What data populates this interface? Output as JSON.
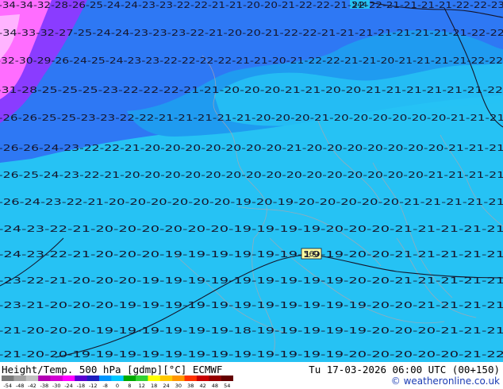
{
  "footer": {
    "left_text": "Height/Temp. 500 hPa [gdmp][°C] ECMWF",
    "right_text": "Tu 17-03-2026 06:00 UTC (00+150)",
    "credit_text": "© weatheronline.co.uk"
  },
  "colorbar": {
    "ticks": [
      "-54",
      "-48",
      "-42",
      "-38",
      "-30",
      "-24",
      "-18",
      "-12",
      "-8",
      "0",
      "8",
      "12",
      "18",
      "24",
      "30",
      "38",
      "42",
      "48",
      "54"
    ],
    "colors": [
      "#7b7b7b",
      "#a3a3a3",
      "#c2c2c2",
      "#b400b4",
      "#d200d2",
      "#ff00ff",
      "#5a00d2",
      "#1e1ebe",
      "#0096ff",
      "#00c8ff",
      "#00aa00",
      "#32d232",
      "#ffff00",
      "#ffc800",
      "#ff9600",
      "#ff3200",
      "#c80000",
      "#960000",
      "#640000"
    ]
  },
  "map": {
    "colors": {
      "magenta": "#ff6dff",
      "pink": "#ffb4ff",
      "purple": "#8a3cff",
      "blue": "#2e78f4",
      "mid_blue": "#1f9bf0",
      "cyan": "#26c2f4",
      "contour": "#15152a",
      "coast": "#b8a4a8"
    },
    "contour_labels": [
      {
        "text": "560",
        "boxed": true
      },
      {
        "text": "544",
        "boxed": true
      }
    ],
    "temp_rows": [
      "-34-34-32-28-26-25-24-24-23-23-22-22-21-21-20-20-21-22-22-21-22-22-21-21-21-21-22-22-23",
      "-34-33-32-27-25-24-24-23-23-23-22-21-20-20-21-22-22-21-21-21-21-21-21-21-21-22-22",
      "-32-30-29-26-24-25-24-23-23-22-22-22-22-21-21-20-21-22-22-21-21-20-21-21-21-21-22-22",
      "-31-28-25-25-25-23-22-22-22-21-21-20-20-20-21-21-20-20-21-21-21-21-21-21-22",
      "-26-26-25-25-23-23-22-22-21-21-21-21-21-20-20-20-21-20-20-20-20-20-20-21-21-21",
      "-26-26-24-23-22-22-21-20-20-20-20-20-20-20-21-20-20-20-20-20-20-20-21-21-21",
      "-26-25-24-23-22-21-20-20-20-20-20-20-20-20-20-20-20-20-20-20-20-21-21-21-21",
      "-26-24-23-22-21-20-20-20-20-20-20-19-20-19-20-20-20-20-20-21-21-21-21-21",
      "-24-23-22-21-20-20-20-20-20-20-19-19-19-19-20-20-20-21-21-21-21-21",
      "-24-23-22-21-20-20-20-19-19-19-19-19-19-19-19-20-20-21-21-21-21-21",
      "-23-22-21-20-20-20-19-19-19-19-19-19-19-19-19-20-20-21-21-21-21-21",
      "-23-21-20-20-20-19-19-19-19-19-19-19-19-19-19-19-20-20-21-21-21-21",
      "-21-20-20-20-19-19-19-19-19-19-18-19-19-19-19-19-20-20-20-21-21-21",
      "-21-20-20-19-19-19-19-19-19-19-19-19-19-19-19-20-20-20-20-20-21-22"
    ]
  }
}
